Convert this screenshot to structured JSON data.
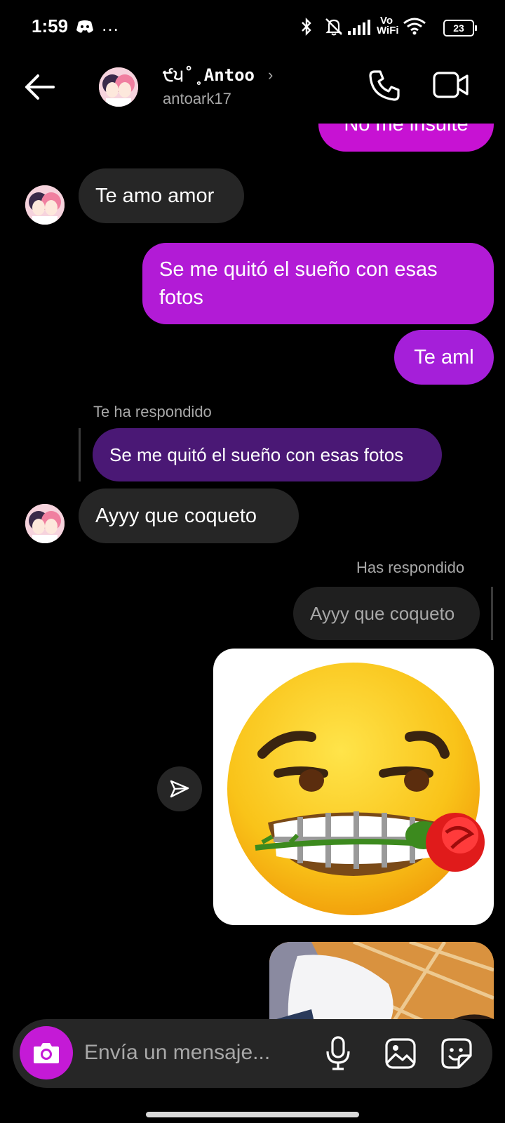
{
  "status_bar": {
    "time": "1:59",
    "ellipsis": "…",
    "battery": "23",
    "network_label": "Vo WiFi"
  },
  "header": {
    "display_name": "੯੫˚˳Antoo",
    "username": "antoark17",
    "chevron": "›"
  },
  "messages": [
    {
      "side": "out",
      "text": "No me insulte"
    },
    {
      "side": "in",
      "text": "Te amo amor"
    },
    {
      "side": "out",
      "text": "Se me quitó el sueño con esas fotos"
    },
    {
      "side": "out",
      "text": "Te aml"
    },
    {
      "side": "in",
      "reply_label": "Te ha respondido",
      "quoted": "Se me quitó el sueño con esas fotos",
      "text": "Ayyy que coqueto"
    },
    {
      "side": "out",
      "reply_label": "Has respondido",
      "quoted": "Ayyy que coqueto"
    }
  ],
  "composer": {
    "placeholder": "Envía un mensaje..."
  },
  "colors": {
    "background": "#000000",
    "incoming_bubble": "#262626",
    "outgoing_bubble": "#a11fd8",
    "quoted_bubble_in": "#4a1875",
    "camera_button": "#c41ad6"
  }
}
